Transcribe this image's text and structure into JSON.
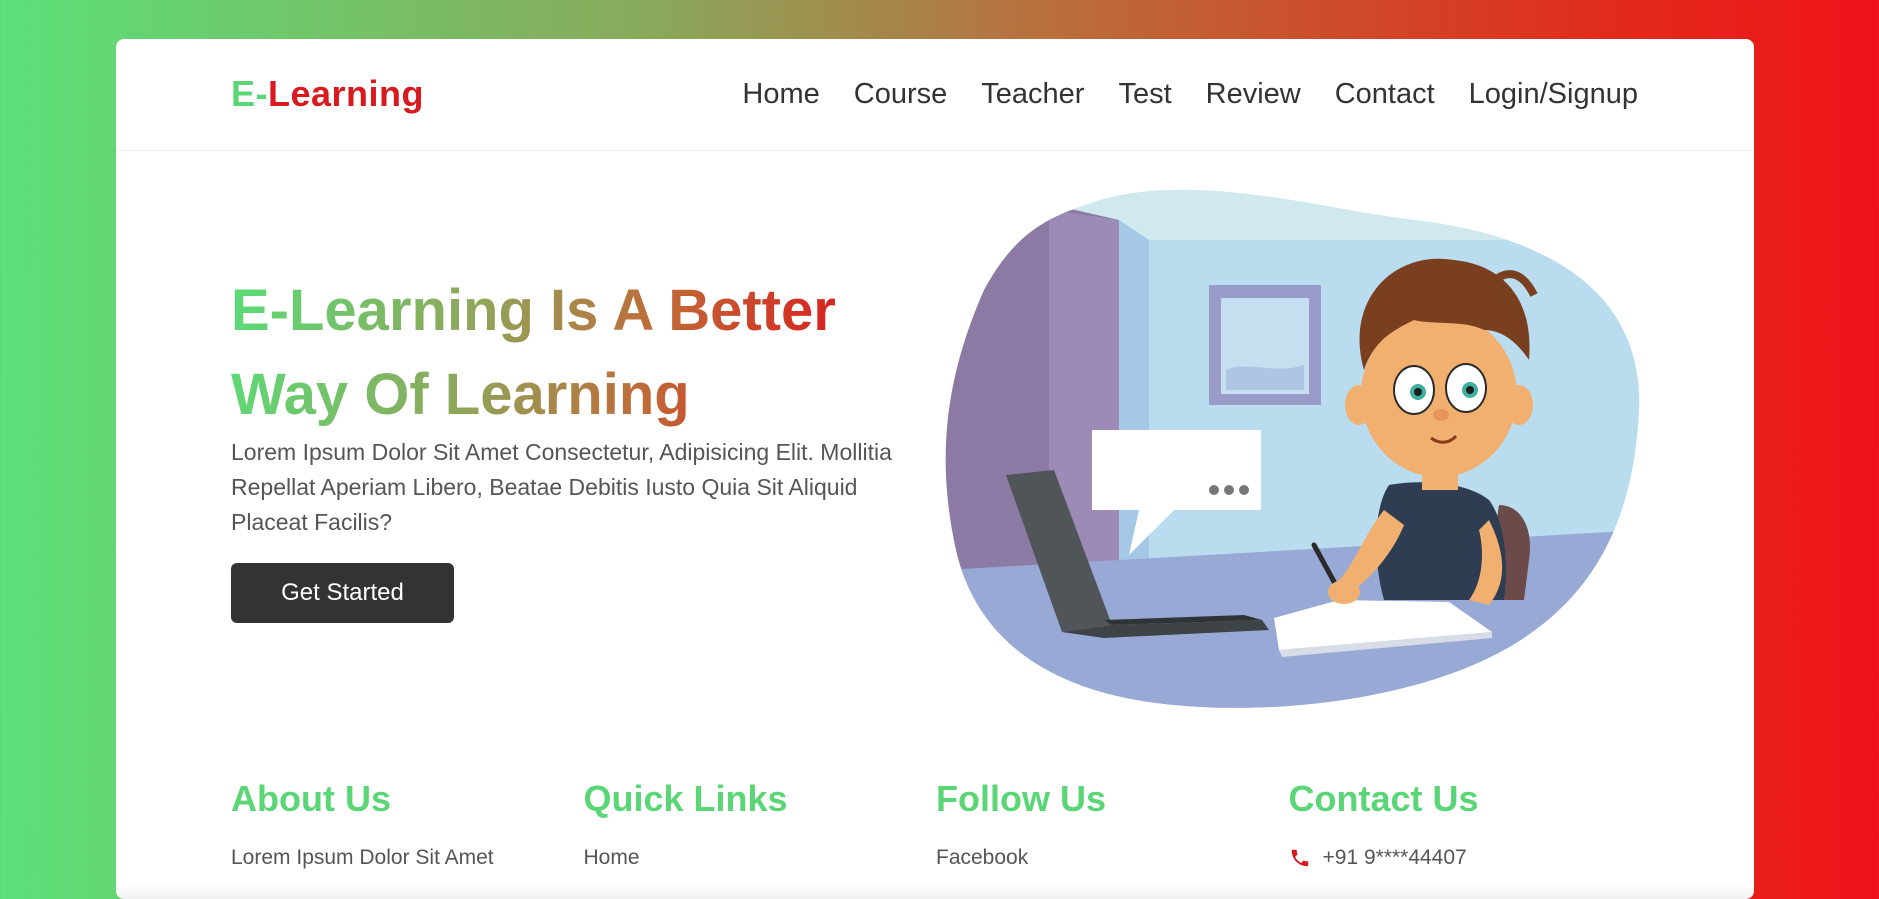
{
  "brand": {
    "logo_part1": "E-",
    "logo_part2": "Learning"
  },
  "nav": {
    "items": [
      "Home",
      "Course",
      "Teacher",
      "Test",
      "Review",
      "Contact",
      "Login/Signup"
    ]
  },
  "hero": {
    "title_line1": "E-Learning Is A Better",
    "title_line2": "Way Of Learning",
    "description": "Lorem Ipsum Dolor Sit Amet Consectetur, Adipisicing Elit. Mollitia Repellat Aperiam Libero, Beatae Debitis Iusto Quia Sit Aliquid Placeat Facilis?",
    "cta_label": "Get Started",
    "illustration_icon": "student-at-laptop-illustration"
  },
  "footer": {
    "about": {
      "heading": "About Us",
      "text": "Lorem Ipsum Dolor Sit Amet"
    },
    "quick_links": {
      "heading": "Quick Links",
      "first": "Home"
    },
    "follow": {
      "heading": "Follow Us",
      "first": "Facebook"
    },
    "contact": {
      "heading": "Contact Us",
      "phone": "+91 9****44407",
      "phone_icon": "phone-icon"
    }
  },
  "colors": {
    "brand_green": "#5bd676",
    "brand_red": "#d81a1f",
    "button_dark": "#333333",
    "text_gray": "#555555"
  }
}
